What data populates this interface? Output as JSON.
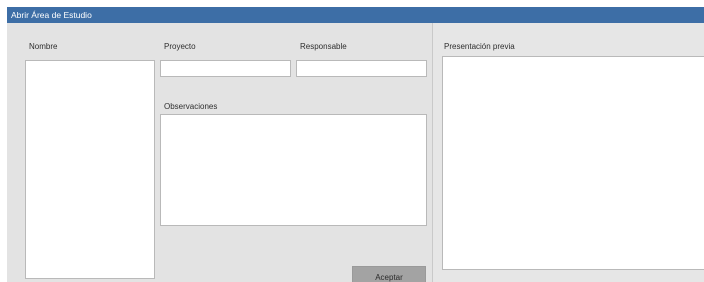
{
  "window": {
    "title": "Abrir Área de Estudio"
  },
  "studies": {
    "nombre_label": "Nombre",
    "items": []
  },
  "form": {
    "proyecto_label": "Proyecto",
    "proyecto_value": "",
    "responsable_label": "Responsable",
    "responsable_value": "",
    "observaciones_label": "Observaciones",
    "observaciones_value": "",
    "accept_label": "Aceptar"
  },
  "preview": {
    "label": "Presentación previa"
  },
  "colors": {
    "titlebar": "#3d6ea6",
    "panel": "#e3e3e3",
    "button": "#a3a3a3"
  }
}
